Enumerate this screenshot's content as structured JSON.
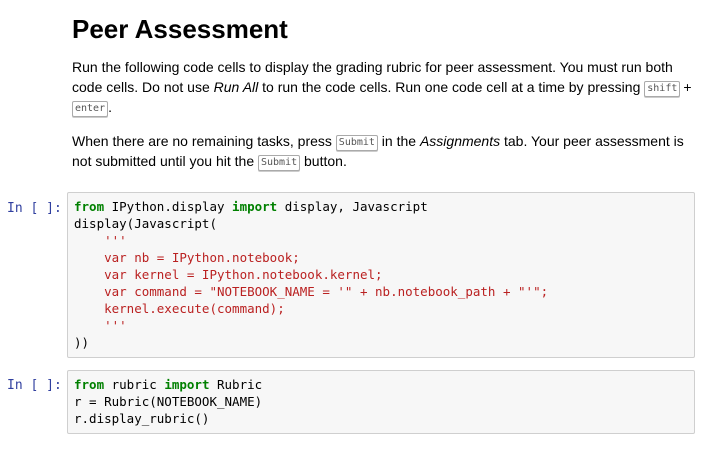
{
  "markdown": {
    "title": "Peer Assessment",
    "p1_text1": "Run the following code cells to display the grading rubric for peer assessment. You must run both code cells. Do not use ",
    "p1_run_all": "Run All",
    "p1_text2": " to run the code cells. Run one code cell at a time by pressing ",
    "p1_key_shift": "shift",
    "p1_plus": "+",
    "p1_key_enter": "enter",
    "p1_end": ".",
    "p2_text1": "When there are no remaining tasks, press ",
    "p2_key_submit1": "Submit",
    "p2_text2": " in the ",
    "p2_assignments": "Assignments",
    "p2_text3": " tab. Your peer assessment is not submitted until you hit the ",
    "p2_key_submit2": "Submit",
    "p2_text4": " button."
  },
  "cells": [
    {
      "prompt": "In [ ]:",
      "lines": [
        {
          "kw1": "from",
          "t1": " IPython.display ",
          "kw2": "import",
          "t2": " display, Javascript"
        },
        {
          "t": "display(Javascript("
        },
        {
          "s": "    '''"
        },
        {
          "s": "    var nb = IPython.notebook;"
        },
        {
          "s": "    var kernel = IPython.notebook.kernel;"
        },
        {
          "s": "    var command = \"NOTEBOOK_NAME = '\" + nb.notebook_path + \"'\";"
        },
        {
          "s": "    kernel.execute(command);"
        },
        {
          "s": "    '''"
        },
        {
          "t": "))"
        }
      ]
    },
    {
      "prompt": "In [ ]:",
      "lines": [
        {
          "kw1": "from",
          "t1": " rubric ",
          "kw2": "import",
          "t2": " Rubric"
        },
        {
          "t": "r = Rubric(NOTEBOOK_NAME)"
        },
        {
          "t": "r.display_rubric()"
        }
      ]
    }
  ]
}
